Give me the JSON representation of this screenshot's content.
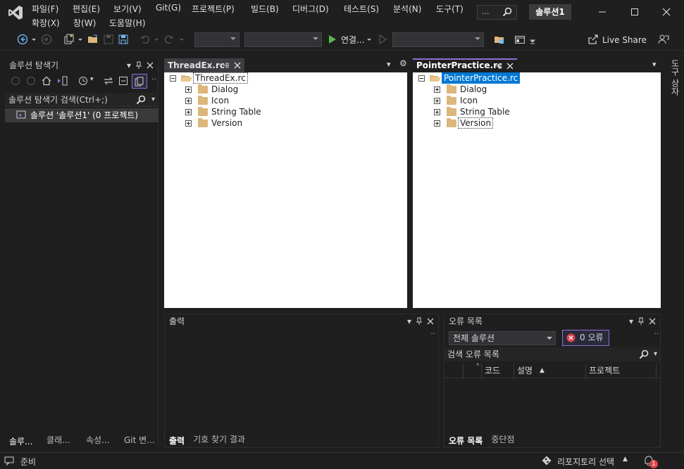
{
  "menu": {
    "row1": [
      "파일(F)",
      "편집(E)",
      "보기(V)",
      "Git(G)",
      "프로젝트(P)",
      "빌드(B)",
      "디버그(D)",
      "테스트(S)",
      "분석(N)",
      "도구(T)"
    ],
    "row2": [
      "확장(X)",
      "창(W)",
      "도움말(H)"
    ]
  },
  "search": {
    "label": "..."
  },
  "solution_name": "솔루션1",
  "toolbar": {
    "start_label": "연결...",
    "live_share": "Live Share"
  },
  "solution_explorer": {
    "title": "솔루션 탐색기",
    "search_placeholder": "솔루션 탐색기 검색(Ctrl+;)",
    "item": "솔루션 '솔루션1' (0 프로젝트)",
    "tabs": [
      "솔루...",
      "클래...",
      "속성...",
      "Git 변..."
    ]
  },
  "doc1": {
    "tab_title": "ThreadEx.rc",
    "root": "ThreadEx.rc",
    "children": [
      "Dialog",
      "Icon",
      "String Table",
      "Version"
    ]
  },
  "doc2": {
    "tab_title": "PointerPractice.rc",
    "root": "PointerPractice.rc",
    "children": [
      "Dialog",
      "Icon",
      "String Table",
      "Version"
    ]
  },
  "output": {
    "title": "출력",
    "tabs": [
      "출력",
      "기호 찾기 결과"
    ]
  },
  "error_list": {
    "title": "오류 목록",
    "scope": "전체 솔루션",
    "errors_label": "0 오류",
    "search_placeholder": "검색 오류 목록",
    "columns": [
      "코드",
      "설명",
      "프로젝트"
    ],
    "tabs": [
      "오류 목록",
      "중단점"
    ]
  },
  "right_strip": "도구 상자",
  "status": {
    "ready": "준비",
    "repo": "리포지토리 선택",
    "notification_count": "1"
  },
  "colors": {
    "accent": "#8f6fd8",
    "selection": "#0078d4",
    "folder": "#dcb67a",
    "play": "#5db552",
    "error": "#e0434b"
  }
}
